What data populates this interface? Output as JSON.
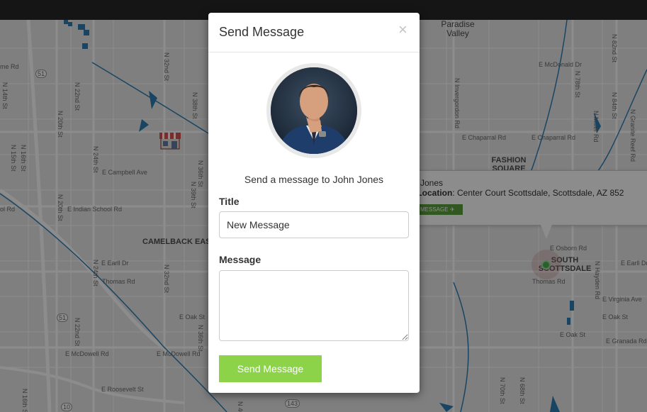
{
  "modal": {
    "title": "Send Message",
    "close_label": "×",
    "send_to_text": "Send a message to John Jones",
    "title_label": "Title",
    "title_value": "New Message",
    "message_label": "Message",
    "message_value": "",
    "send_button_label": "Send Message"
  },
  "map": {
    "area_labels": [
      "CAMELBACK EAST VILLAGE",
      "FASHION SQUARE",
      "SOUTH SCOTTSDALE"
    ],
    "city_label": "Paradise Valley",
    "streets": {
      "e_campbell": "E Campbell Ave",
      "e_indian_school": "E Indian School Rd",
      "e_earll": "E Earll Dr",
      "thomas": "Thomas Rd",
      "thomas2": "Thomas Rd",
      "e_oak": "E Oak St",
      "e_mcdowell": "E McDowell Rd",
      "e_mcdowell2": "E McDowell Rd",
      "e_roosevelt": "E Roosevelt St",
      "e_chaparral": "E Chaparral Rd",
      "e_chaparral2": "E Chaparral Rd",
      "e_mcdonald": "E McDonald Dr",
      "e_osborn": "E Osborn Rd",
      "e_virginia": "E Virginia Ave",
      "e_oak2": "E Oak St",
      "e_oak3": "E Oak St",
      "e_granada": "E Granada Rd",
      "e_earll2": "E Earll Dr",
      "me_rd": "me Rd",
      "ol_rd": "ol Rd",
      "n_16th": "N 16th St",
      "n_15th": "N 15th St",
      "n_14th": "N 14th St",
      "n_20th": "N 20th St",
      "n_20th2": "N 20th St",
      "n_22nd": "N 22nd St",
      "n_24th": "N 24th St",
      "n_24th2": "N 24th St",
      "n_32nd": "N 32nd St",
      "n_36th": "N 36th St",
      "n_38th": "N 38th St",
      "n_39th": "N 39th St",
      "n_40th": "N 40th St",
      "n_68th": "N 68th St",
      "n_70th": "N 70th St",
      "n_78th": "N 78th St",
      "n_82nd": "N 82nd St",
      "n_84th": "N 84th St",
      "n_hayden": "N Hayden Rd",
      "n_granite": "N Granite Reef Rd",
      "n_miller": "N Miller Rd",
      "n_invergordon": "N Invergordon Rd",
      "n_16th2": "N 16th St",
      "n_22nd2": "N 22nd St",
      "route_51": "51",
      "route_51b": "51",
      "route_10": "10",
      "route_143": "143"
    }
  },
  "infowindow": {
    "name": "Jones",
    "location_label": "ent Location",
    "location_value": ": Center Court Scottsdale, Scottsdale, AZ 852",
    "message_button": "MESSAGE"
  },
  "colors": {
    "send_button": "#8cd34a",
    "marker": "#4caf50",
    "water": "#2f7fb5"
  }
}
